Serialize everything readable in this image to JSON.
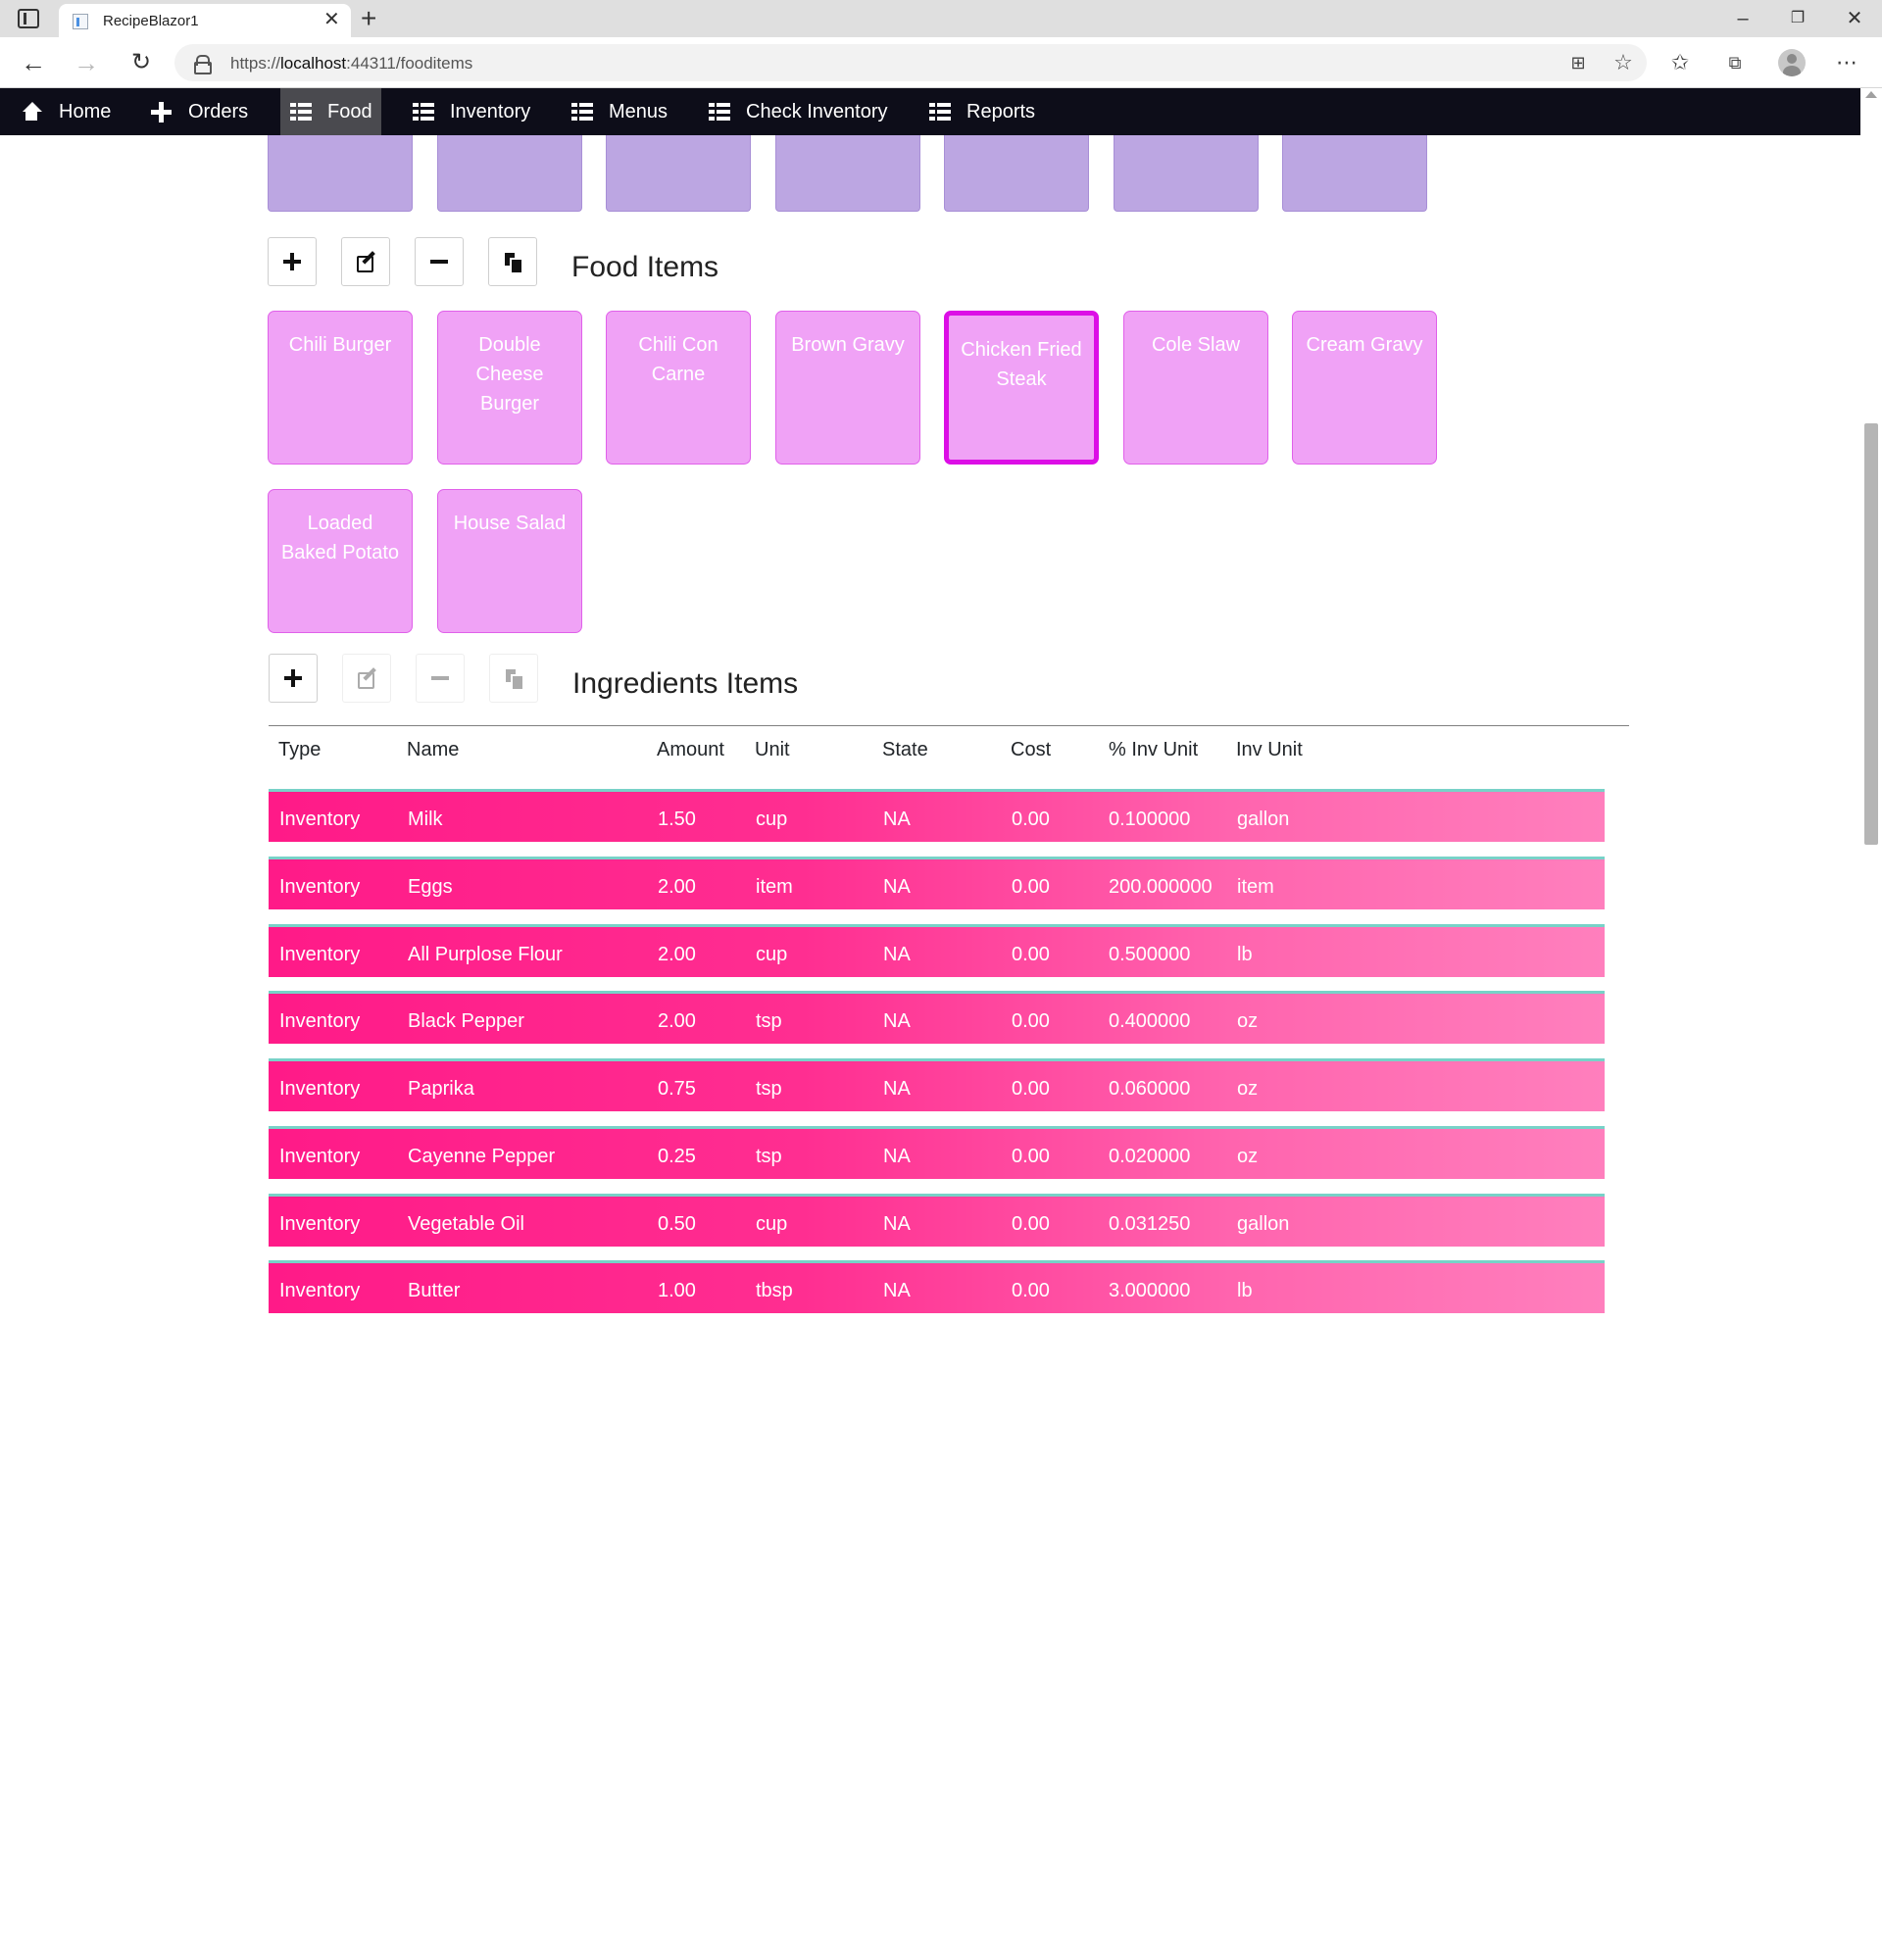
{
  "browser": {
    "tab_title": "RecipeBlazor1",
    "url_prefix": "https://",
    "url_host": "localhost",
    "url_rest": ":44311/fooditems",
    "icons": [
      "tab-actions-icon",
      "favicon-icon",
      "close-icon",
      "new-tab-icon",
      "minimize-icon",
      "restore-icon",
      "window-close-icon",
      "back-icon",
      "forward-icon",
      "refresh-icon",
      "lock-icon",
      "app-available-icon",
      "add-favorite-icon",
      "favorites-icon",
      "collections-icon",
      "profile-avatar",
      "more-icon"
    ]
  },
  "nav": {
    "items": [
      {
        "label": "Home",
        "icon": "home-icon"
      },
      {
        "label": "Orders",
        "icon": "plus-icon"
      },
      {
        "label": "Food",
        "icon": "list-icon",
        "active": true
      },
      {
        "label": "Inventory",
        "icon": "list-icon"
      },
      {
        "label": "Menus",
        "icon": "list-icon"
      },
      {
        "label": "Check Inventory",
        "icon": "list-icon"
      },
      {
        "label": "Reports",
        "icon": "list-icon"
      }
    ]
  },
  "categories": {
    "count_visible": 7,
    "color": "#bca6e2"
  },
  "food_section": {
    "title": "Food Items",
    "toolbar": [
      "add-icon",
      "edit-icon",
      "remove-icon",
      "copy-icon"
    ],
    "items": [
      {
        "name": "Chili Burger"
      },
      {
        "name": "Double Cheese Burger"
      },
      {
        "name": "Chili Con Carne"
      },
      {
        "name": "Brown Gravy"
      },
      {
        "name": "Chicken Fried Steak",
        "selected": true
      },
      {
        "name": "Cole Slaw"
      },
      {
        "name": "Cream Gravy"
      },
      {
        "name": "Loaded Baked Potato"
      },
      {
        "name": "House Salad"
      }
    ],
    "tile_color": "#f0a2f6",
    "selected_border_color": "#dc0ee6"
  },
  "ingredients_section": {
    "title": "Ingredients Items",
    "toolbar": [
      {
        "icon": "add-icon",
        "enabled": true
      },
      {
        "icon": "edit-icon",
        "enabled": false
      },
      {
        "icon": "remove-icon",
        "enabled": false
      },
      {
        "icon": "copy-icon",
        "enabled": false
      }
    ],
    "columns": [
      "Type",
      "Name",
      "Amount",
      "Unit",
      "State",
      "Cost",
      "% Inv Unit",
      "Inv Unit"
    ],
    "rows": [
      {
        "type": "Inventory",
        "name": "Milk",
        "amount": "1.50",
        "unit": "cup",
        "state": "NA",
        "cost": "0.00",
        "pct_inv_unit": "0.100000",
        "inv_unit": "gallon"
      },
      {
        "type": "Inventory",
        "name": "Eggs",
        "amount": "2.00",
        "unit": "item",
        "state": "NA",
        "cost": "0.00",
        "pct_inv_unit": "200.000000",
        "inv_unit": "item"
      },
      {
        "type": "Inventory",
        "name": "All Purplose Flour",
        "amount": "2.00",
        "unit": "cup",
        "state": "NA",
        "cost": "0.00",
        "pct_inv_unit": "0.500000",
        "inv_unit": "lb"
      },
      {
        "type": "Inventory",
        "name": "Black Pepper",
        "amount": "2.00",
        "unit": "tsp",
        "state": "NA",
        "cost": "0.00",
        "pct_inv_unit": "0.400000",
        "inv_unit": "oz"
      },
      {
        "type": "Inventory",
        "name": "Paprika",
        "amount": "0.75",
        "unit": "tsp",
        "state": "NA",
        "cost": "0.00",
        "pct_inv_unit": "0.060000",
        "inv_unit": "oz"
      },
      {
        "type": "Inventory",
        "name": "Cayenne Pepper",
        "amount": "0.25",
        "unit": "tsp",
        "state": "NA",
        "cost": "0.00",
        "pct_inv_unit": "0.020000",
        "inv_unit": "oz"
      },
      {
        "type": "Inventory",
        "name": "Vegetable Oil",
        "amount": "0.50",
        "unit": "cup",
        "state": "NA",
        "cost": "0.00",
        "pct_inv_unit": "0.031250",
        "inv_unit": "gallon"
      },
      {
        "type": "Inventory",
        "name": "Butter",
        "amount": "1.00",
        "unit": "tbsp",
        "state": "NA",
        "cost": "0.00",
        "pct_inv_unit": "3.000000",
        "inv_unit": "lb"
      }
    ],
    "row_color": "#ff1a88",
    "row_accent_color": "#78d2c8"
  }
}
